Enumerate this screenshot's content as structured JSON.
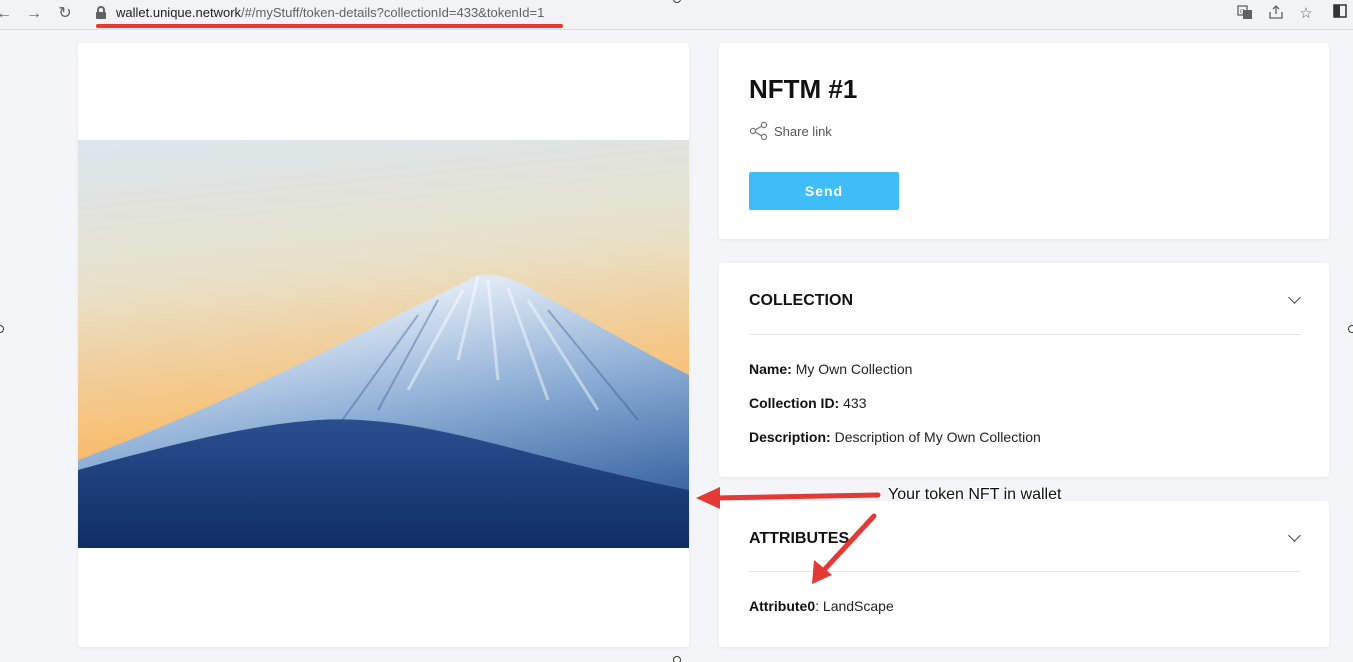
{
  "browser": {
    "url_host": "wallet.unique.network",
    "url_path": "/#/myStuff/token-details?collectionId=433&tokenId=1",
    "back_icon": "back-arrow-icon",
    "forward_icon": "forward-arrow-icon",
    "reload_icon": "reload-icon",
    "toolbar_icons": [
      "translate-icon",
      "share-icon",
      "star-icon",
      "sidebar-icon"
    ]
  },
  "token": {
    "title": "NFTM #1",
    "share_label": "Share link",
    "send_label": "Send"
  },
  "collection": {
    "heading": "COLLECTION",
    "name_label": "Name:",
    "name_value": "My Own Collection",
    "id_label": "Collection ID:",
    "id_value": "433",
    "description_label": "Description:",
    "description_value": "Description of My Own Collection"
  },
  "attributes": {
    "heading": "ATTRIBUTES",
    "items": [
      {
        "label": "Attribute0",
        "value": "LandScape"
      }
    ]
  },
  "annotation": {
    "text": "Your token NFT in wallet",
    "color": "#e53935"
  },
  "colors": {
    "accent": "#3fbdf9",
    "background": "#f4f5f9"
  }
}
